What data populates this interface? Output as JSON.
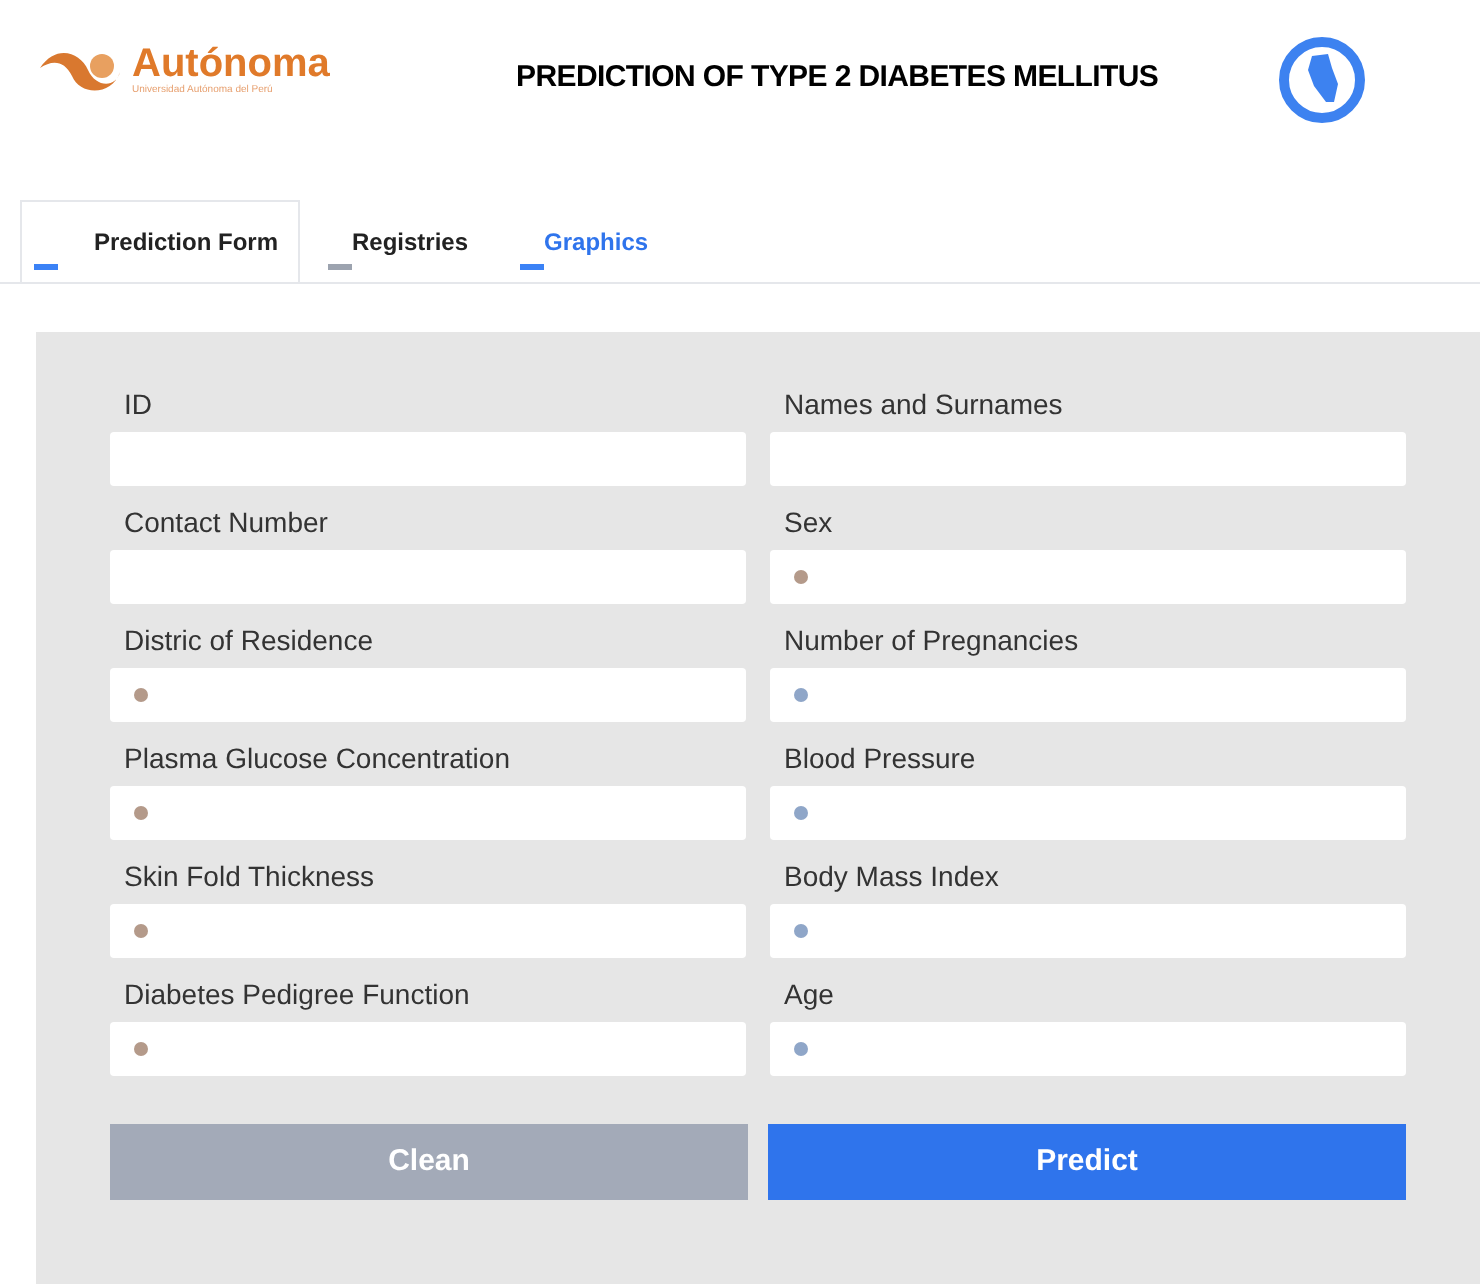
{
  "header": {
    "logo_name": "Autónoma",
    "logo_subtitle": "Universidad Autónoma del Perú",
    "title": "PREDICTION OF TYPE 2 DIABETES MELLITUS"
  },
  "tabs": [
    {
      "label": "Prediction Form",
      "selected": true,
      "linked": false,
      "color": "#3b82f6"
    },
    {
      "label": "Registries",
      "selected": false,
      "linked": false,
      "color": "#9ca3af"
    },
    {
      "label": "Graphics",
      "selected": false,
      "linked": true,
      "color": "#3b82f6"
    }
  ],
  "fields": [
    {
      "label": "ID",
      "kind": "plain"
    },
    {
      "label": "Names and Surnames",
      "kind": "plain"
    },
    {
      "label": "Contact Number",
      "kind": "plain"
    },
    {
      "label": "Sex",
      "kind": "dotted",
      "color": "#b49a8a"
    },
    {
      "label": "Distric of Residence",
      "kind": "dotted",
      "color": "#b49a8a"
    },
    {
      "label": "Number of Pregnancies",
      "kind": "dotted",
      "color": "#8fa6c8"
    },
    {
      "label": "Plasma Glucose Concentration",
      "kind": "dotted",
      "color": "#b49a8a"
    },
    {
      "label": "Blood Pressure",
      "kind": "dotted",
      "color": "#8fa6c8"
    },
    {
      "label": "Skin Fold Thickness",
      "kind": "dotted",
      "color": "#b49a8a"
    },
    {
      "label": "Body Mass Index",
      "kind": "dotted",
      "color": "#8fa6c8"
    },
    {
      "label": "Diabetes Pedigree Function",
      "kind": "dotted",
      "color": "#b49a8a"
    },
    {
      "label": "Age",
      "kind": "dotted",
      "color": "#8fa6c8"
    }
  ],
  "buttons": [
    {
      "label": "Clean",
      "kind": "secondary"
    },
    {
      "label": "Predict",
      "kind": "primary"
    }
  ]
}
